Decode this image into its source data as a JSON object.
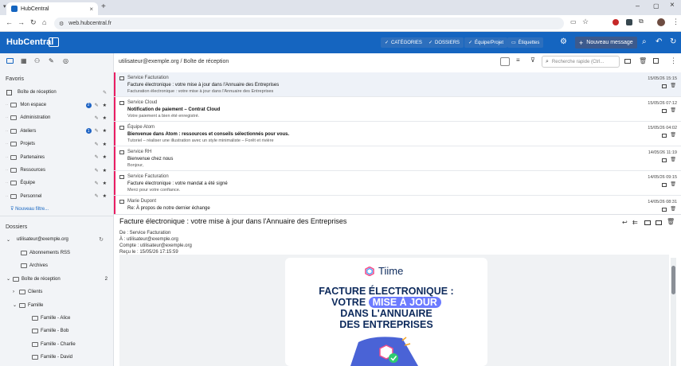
{
  "browser": {
    "tab_title": "HubCentral",
    "url": "web.hubcentral.fr"
  },
  "header": {
    "logo": "HubCentral",
    "buttons": [
      "CATÉGORIES",
      "DOSSIERS",
      "Équipe/Projet",
      "Étiquettes"
    ],
    "new_message": "Nouveau message"
  },
  "sidebar": {
    "favorites_title": "Favoris",
    "inbox_label": "Boîte de réception",
    "favorites": [
      {
        "label": "Mon espace",
        "badge": "2"
      },
      {
        "label": "Administration",
        "badge": ""
      },
      {
        "label": "Ateliers",
        "badge": "1"
      },
      {
        "label": "Projets",
        "badge": ""
      },
      {
        "label": "Partenaires",
        "badge": ""
      },
      {
        "label": "Ressources",
        "badge": ""
      },
      {
        "label": "Équipe",
        "badge": ""
      },
      {
        "label": "Personnel",
        "badge": ""
      }
    ],
    "new_filter": "Nouveau filtre...",
    "folders_title": "Dossiers",
    "account": "utilisateur@exemple.org",
    "folders": [
      {
        "label": "Abonnements RSS",
        "count": ""
      },
      {
        "label": "Archives",
        "count": ""
      },
      {
        "label": "Boîte de réception",
        "count": "2"
      },
      {
        "label": "Clients",
        "count": ""
      },
      {
        "label": "Famille",
        "count": ""
      },
      {
        "label": "Famille - Alice",
        "count": ""
      },
      {
        "label": "Famille - Bob",
        "count": ""
      },
      {
        "label": "Famille - Charlie",
        "count": ""
      },
      {
        "label": "Famille - David",
        "count": ""
      }
    ]
  },
  "list": {
    "breadcrumb": "utilisateur@exemple.org / Boîte de réception",
    "search_placeholder": "Recherche rapide (Ctrl...",
    "messages": [
      {
        "from": "Service Facturation",
        "subject": "Facture électronique : votre mise à jour dans l'Annuaire des Entreprises",
        "preview": "Facturation électronique : votre mise à jour dans l'Annuaire des Entreprises",
        "date": "15/05/26 15:15"
      },
      {
        "from": "Service Cloud",
        "subject": "Notification de paiement – Contrat Cloud",
        "preview": "Votre paiement a bien été enregistré.",
        "date": "15/05/26 07:12"
      },
      {
        "from": "Équipe Atom",
        "subject": "Bienvenue dans Atom : ressources et conseils sélectionnés pour vous.",
        "preview": "Tutoriel – réaliser une illustration avec un style minimaliste – Forêt et rivière",
        "date": "15/05/26 04:02"
      },
      {
        "from": "Service RH",
        "subject": "Bienvenue chez nous",
        "preview": "Bonjour,",
        "date": "14/05/26 11:19"
      },
      {
        "from": "Service Facturation",
        "subject": "Facture électronique : votre mandat a été signé",
        "preview": "Merci pour votre confiance.",
        "date": "14/05/26 09:15"
      },
      {
        "from": "Marie Dupont",
        "subject": "Re: À propos de notre dernier échange",
        "preview": "",
        "date": "14/05/26 08:31"
      }
    ]
  },
  "reader": {
    "subject": "Facture électronique : votre mise à jour dans l'Annuaire des Entreprises",
    "from_line": "De : Service Facturation",
    "to_line": "À : utilisateur@exemple.org",
    "account_line": "Compte : utilisateur@exemple.org",
    "received_line": "Reçu le : 15/05/26 17:15:59",
    "card": {
      "brand": "Tiime",
      "line1": "FACTURE ÉLECTRONIQUE :",
      "line2_a": "VOTRE",
      "line2_b": "MISE À JOUR",
      "line3": "DANS L'ANNUAIRE",
      "line4": "DES ENTREPRISES"
    }
  },
  "colors": {
    "header": "#1565c0",
    "unread_bar": "#e91e63",
    "badge": "#1e63c4"
  }
}
